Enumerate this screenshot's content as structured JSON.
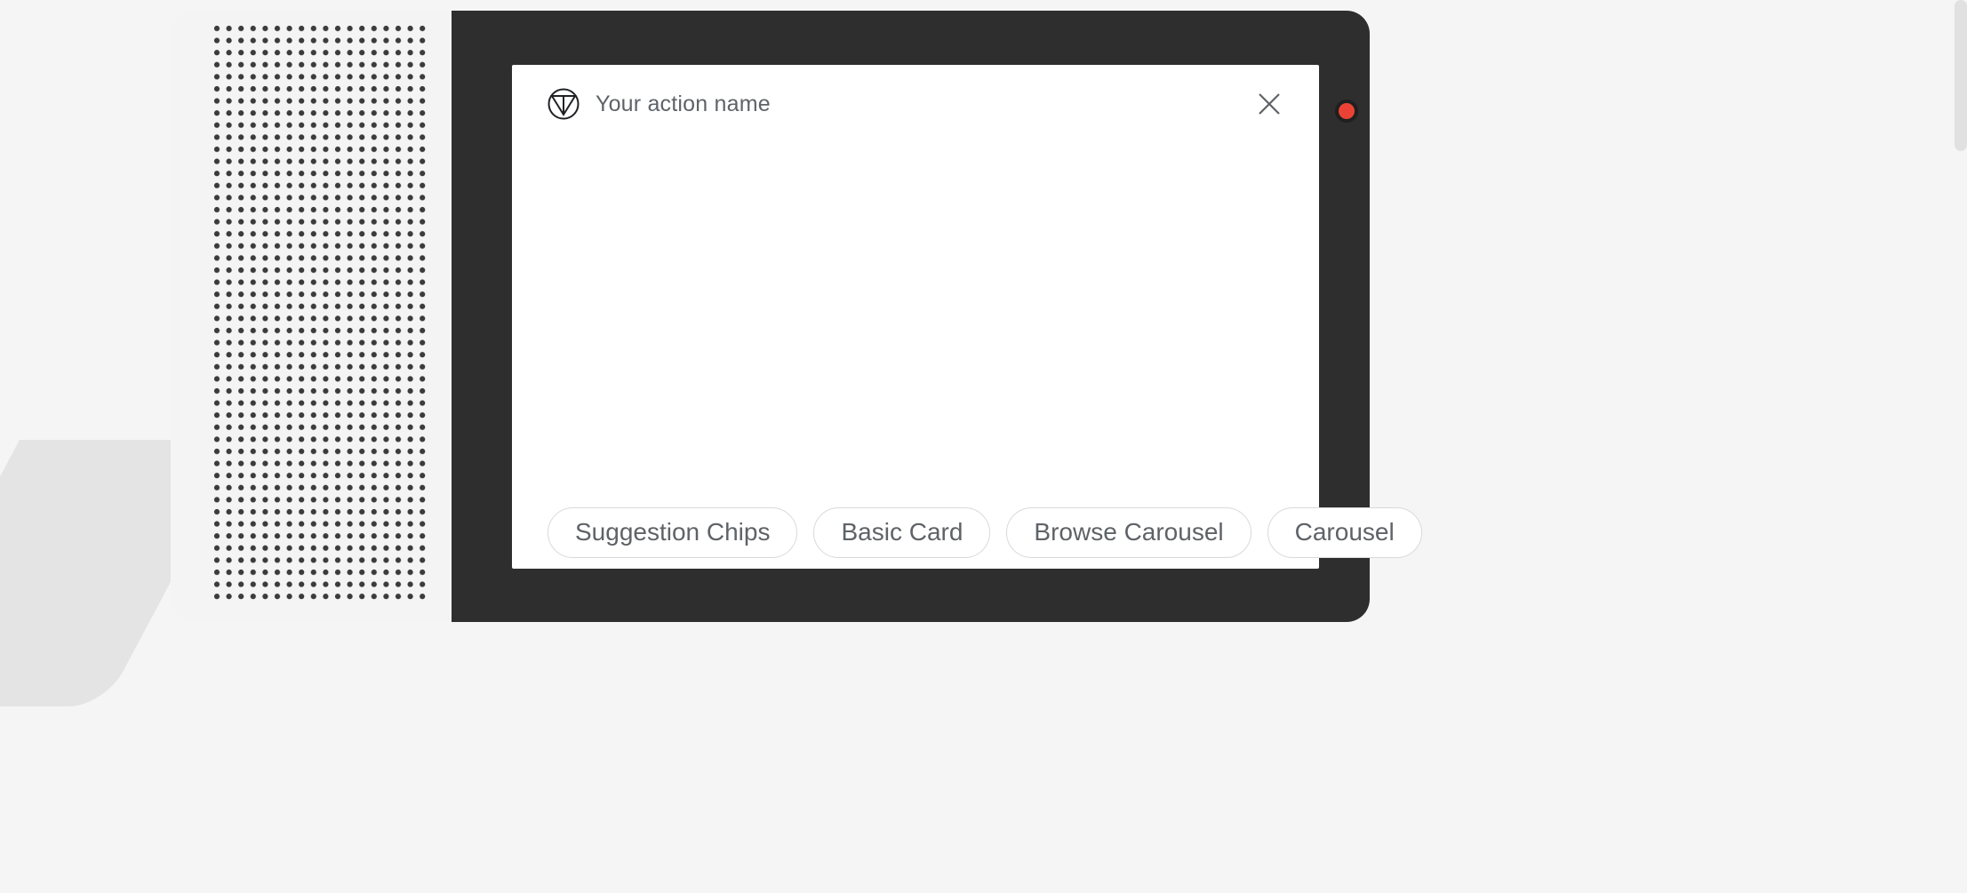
{
  "header": {
    "action_name": "Your action name"
  },
  "chips": {
    "items": [
      {
        "label": "Suggestion Chips"
      },
      {
        "label": "Basic Card"
      },
      {
        "label": "Browse Carousel"
      },
      {
        "label": "Carousel"
      }
    ]
  }
}
